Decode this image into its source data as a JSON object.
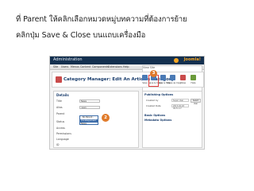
{
  "instructions": {
    "line1": "ที่ Parent ให้คลิกเลือกหมวดหมู่บทความที่ต้องการย้าย",
    "line2": "คลิกปุ่ม Save & Close บนแถบเครื่องมือ"
  },
  "screenshot": {
    "admin_title": "Administration",
    "brand": "Joomla!",
    "menu": [
      "Site",
      "Users",
      "Menus",
      "Content",
      "Components",
      "Extensions",
      "Help"
    ],
    "menu_right": "View Site",
    "page_title": "Category Manager: Edit An Articles Category",
    "toolbar_buttons": [
      {
        "label": "Save",
        "icon": "save-icon",
        "color": "#4a7ab5"
      },
      {
        "label": "Save & Close",
        "icon": "save-close-icon",
        "color": "#4a7ab5"
      },
      {
        "label": "Save & New",
        "icon": "save-new-icon",
        "color": "#4a7ab5"
      },
      {
        "label": "Save as Copy",
        "icon": "save-copy-icon",
        "color": "#4a7ab5"
      },
      {
        "label": "Close",
        "icon": "close-icon",
        "color": "#c94b4b"
      },
      {
        "label": "Help",
        "icon": "help-icon",
        "color": "#6a9a3a"
      }
    ],
    "callout_save_close": "3",
    "callout_parent": "2",
    "details": {
      "section_title": "Details",
      "fields": [
        {
          "label": "Title",
          "value": "News"
        },
        {
          "label": "Alias",
          "value": "news"
        },
        {
          "label": "Parent",
          "value": ""
        },
        {
          "label": "Status",
          "value": ""
        },
        {
          "label": "Access",
          "value": ""
        },
        {
          "label": "Permissions",
          "value": ""
        },
        {
          "label": "Language",
          "value": ""
        },
        {
          "label": "ID",
          "value": ""
        }
      ],
      "parent_options": [
        "- No Parent -",
        "Uncategorised",
        "News"
      ],
      "parent_selected_index": 1
    },
    "options_panel": {
      "publishing_title": "Publishing Options",
      "created_by_label": "Created by",
      "created_by_value": "Super User",
      "select_user_button": "Select User",
      "created_date_label": "Created Date",
      "created_date_value": "2013-04-18 09:51:17",
      "basic_options_title": "Basic Options",
      "metadata_title": "Metadata Options"
    },
    "accent_color": "#14304f",
    "callout_color": "#e07a2a",
    "highlight_color": "#e04040"
  }
}
